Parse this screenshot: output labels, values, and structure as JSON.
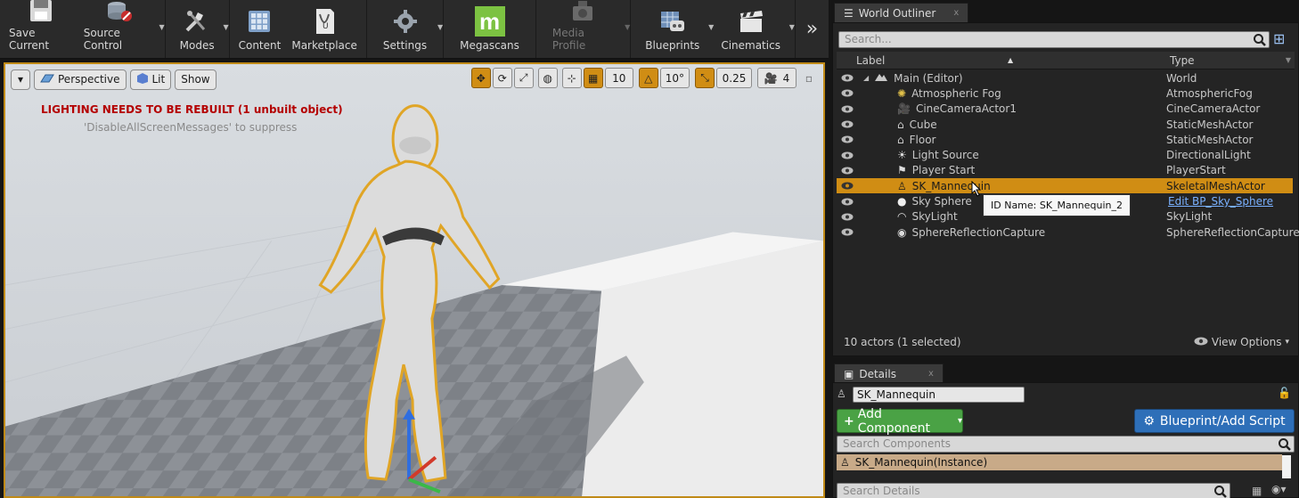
{
  "toolbar": {
    "buttons": [
      {
        "label": "Save Current",
        "icon": "save-icon"
      },
      {
        "label": "Source Control",
        "icon": "source-control-icon"
      },
      {
        "label": "Modes",
        "icon": "modes-icon"
      },
      {
        "label": "Content",
        "icon": "content-icon"
      },
      {
        "label": "Marketplace",
        "icon": "marketplace-icon"
      },
      {
        "label": "Settings",
        "icon": "settings-icon"
      },
      {
        "label": "Megascans",
        "icon": "megascans-icon"
      },
      {
        "label": "Media Profile",
        "icon": "media-profile-icon"
      },
      {
        "label": "Blueprints",
        "icon": "blueprints-icon"
      },
      {
        "label": "Cinematics",
        "icon": "cinematics-icon"
      }
    ],
    "megascans_glyph": "m",
    "more_glyph": "»"
  },
  "viewport": {
    "menu_glyph": "▾",
    "perspective_label": "Perspective",
    "lit_label": "Lit",
    "show_label": "Show",
    "grid_snap": "10",
    "rotation_snap": "10°",
    "scale_snap": "0.25",
    "camera_speed": "4",
    "warning": "LIGHTING NEEDS TO BE REBUILT (1 unbuilt object)",
    "warning_sub": "'DisableAllScreenMessages' to suppress",
    "accent": "#d08d14"
  },
  "outliner": {
    "tab_title": "World Outliner",
    "tab_close": "x",
    "search_placeholder": "Search...",
    "col_label": "Label",
    "col_type": "Type",
    "rows": [
      {
        "label": "Main (Editor)",
        "type": "World",
        "icon": "world-icon"
      },
      {
        "label": "Atmospheric Fog",
        "type": "AtmosphericFog",
        "icon": "fog-icon"
      },
      {
        "label": "CineCameraActor1",
        "type": "CineCameraActor",
        "icon": "camera-icon"
      },
      {
        "label": "Cube",
        "type": "StaticMeshActor",
        "icon": "static-mesh-icon"
      },
      {
        "label": "Floor",
        "type": "StaticMeshActor",
        "icon": "static-mesh-icon"
      },
      {
        "label": "Light Source",
        "type": "DirectionalLight",
        "icon": "directional-light-icon"
      },
      {
        "label": "Player Start",
        "type": "PlayerStart",
        "icon": "player-start-icon"
      },
      {
        "label": "SK_Mannequin",
        "type": "SkeletalMeshActor",
        "icon": "skeletal-mesh-icon"
      },
      {
        "label": "Sky Sphere",
        "type": "Edit BP_Sky_Sphere",
        "icon": "sphere-icon"
      },
      {
        "label": "SkyLight",
        "type": "SkyLight",
        "icon": "sky-light-icon"
      },
      {
        "label": "SphereReflectionCapture",
        "type": "SphereReflectionCapture",
        "icon": "reflection-capture-icon"
      }
    ],
    "tooltip": "ID Name: SK_Mannequin_2",
    "footer": "10 actors (1 selected)",
    "view_options": "View Options",
    "view_options_caret": "▾"
  },
  "details": {
    "tab_title": "Details",
    "tab_close": "x",
    "name_value": "SK_Mannequin",
    "add_component": "Add Component",
    "add_component_glyph": "+",
    "add_component_caret": "▾",
    "blueprint": "Blueprint/Add Script",
    "search_components": "Search Components",
    "instance": "SK_Mannequin(Instance)",
    "search_details": "Search Details"
  }
}
